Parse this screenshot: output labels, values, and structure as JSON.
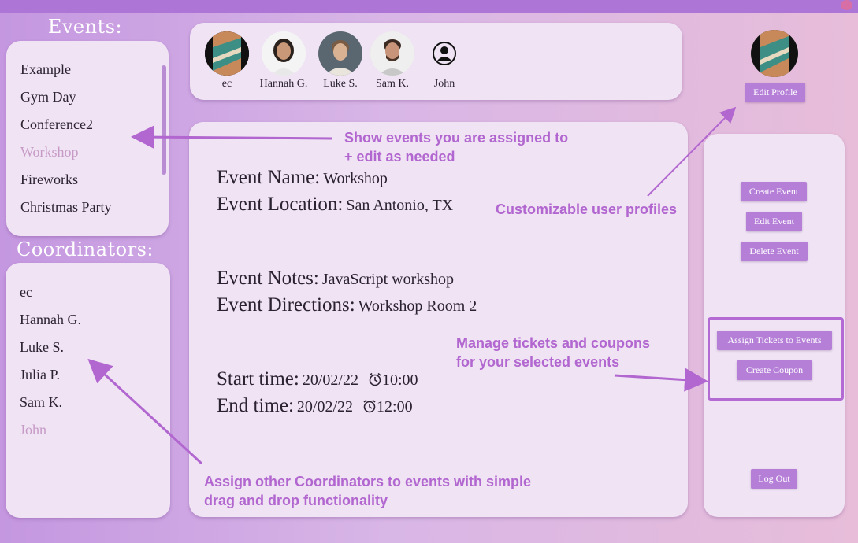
{
  "sidebar": {
    "events_heading": "Events:",
    "events": [
      "Example",
      "Gym Day",
      "Conference2",
      "Workshop",
      "Fireworks",
      "Christmas Party"
    ],
    "coordinators_heading": "Coordinators:",
    "coordinators": [
      "ec",
      "Hannah G.",
      "Luke S.",
      "Julia P.",
      "Sam K.",
      "John"
    ]
  },
  "team_bar": {
    "members": [
      "ec",
      "Hannah G.",
      "Luke S.",
      "Sam K.",
      "John"
    ]
  },
  "event": {
    "name_label": "Event Name:",
    "name_value": "Workshop",
    "location_label": "Event Location:",
    "location_value": "San Antonio, TX",
    "notes_label": "Event Notes:",
    "notes_value": "JavaScript workshop",
    "directions_label": "Event Directions:",
    "directions_value": "Workshop Room 2",
    "start_label": "Start time:",
    "start_date": "20/02/22",
    "start_time": "10:00",
    "end_label": "End time:",
    "end_date": "20/02/22",
    "end_time": "12:00"
  },
  "profile": {
    "edit_label": "Edit Profile"
  },
  "actions": {
    "create_event": "Create Event",
    "edit_event": "Edit Event",
    "delete_event": "Delete Event",
    "assign_tickets": "Assign Tickets to Events",
    "create_coupon": "Create Coupon",
    "log_out": "Log Out"
  },
  "annotations": {
    "events_line1": "Show events you are assigned to",
    "events_line2": "+ edit as needed",
    "profiles": "Customizable user profiles",
    "tickets_line1": "Manage tickets and coupons",
    "tickets_line2": "for your selected events",
    "coordinators_line1": "Assign other Coordinators to events with simple",
    "coordinators_line2": "drag and drop functionality"
  },
  "colors": {
    "accent": "#b57fd8",
    "annotation": "#b266cf",
    "panel": "#efe3f4",
    "muted_item": "#c79ac6"
  }
}
